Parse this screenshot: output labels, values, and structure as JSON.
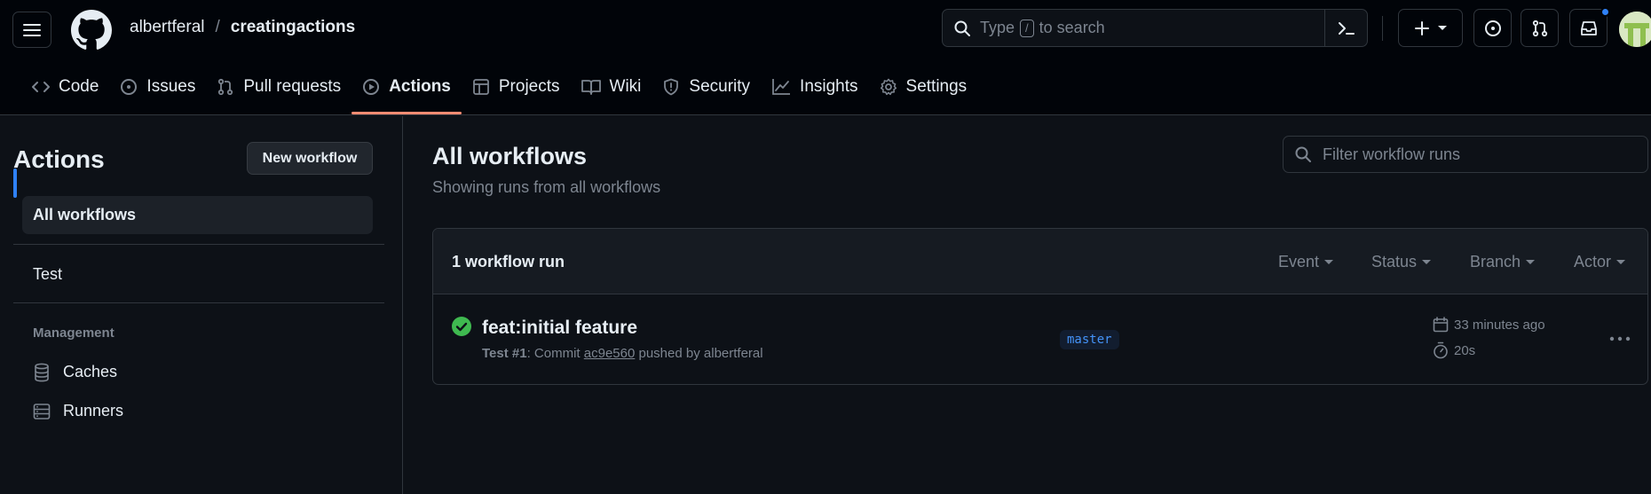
{
  "header": {
    "owner": "albertferal",
    "separator": "/",
    "repo": "creatingactions",
    "search": {
      "prefix": "Type",
      "key": "/",
      "suffix": "to search"
    }
  },
  "tabs": [
    {
      "label": "Code",
      "icon": "code-icon"
    },
    {
      "label": "Issues",
      "icon": "issue-icon"
    },
    {
      "label": "Pull requests",
      "icon": "pull-request-icon"
    },
    {
      "label": "Actions",
      "icon": "play-icon",
      "active": true
    },
    {
      "label": "Projects",
      "icon": "table-icon"
    },
    {
      "label": "Wiki",
      "icon": "book-icon"
    },
    {
      "label": "Security",
      "icon": "shield-icon"
    },
    {
      "label": "Insights",
      "icon": "graph-icon"
    },
    {
      "label": "Settings",
      "icon": "gear-icon"
    }
  ],
  "sidebar": {
    "title": "Actions",
    "new_workflow": "New workflow",
    "items": [
      {
        "label": "All workflows",
        "active": true
      },
      {
        "label": "Test"
      }
    ],
    "management_heading": "Management",
    "management": [
      {
        "label": "Caches",
        "icon": "database-icon"
      },
      {
        "label": "Runners",
        "icon": "server-icon"
      }
    ]
  },
  "main": {
    "title": "All workflows",
    "subtitle": "Showing runs from all workflows",
    "filter_placeholder": "Filter workflow runs",
    "runs_count": "1 workflow run",
    "filters": [
      "Event",
      "Status",
      "Branch",
      "Actor"
    ],
    "run": {
      "name": "feat:initial feature",
      "workflow": "Test #1",
      "meta_commit_label": ": Commit",
      "sha": "ac9e560",
      "meta_pushed": "pushed by albertferal",
      "branch": "master",
      "time": "33 minutes ago",
      "duration": "20s",
      "status": "success"
    }
  },
  "colors": {
    "accent": "#2f81f7",
    "tab_underline": "#fd8c73",
    "success": "#3fb950"
  }
}
